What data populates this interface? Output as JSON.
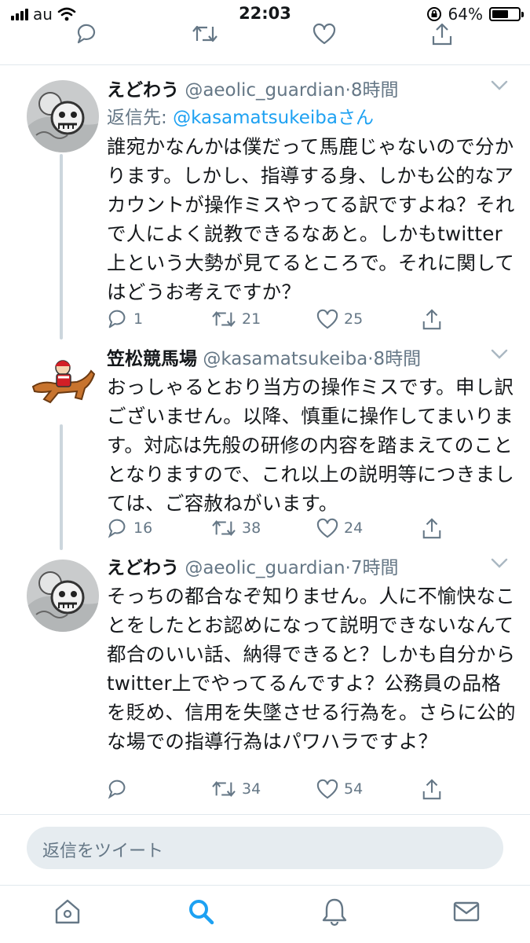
{
  "status_bar": {
    "carrier": "au",
    "time": "22:03",
    "battery_percent": "64%",
    "battery_level": 0.64,
    "icons": [
      "signal-bars-icon",
      "wifi-icon",
      "rotation-lock-icon",
      "battery-icon"
    ]
  },
  "tweets": [
    {
      "name": "えどわう",
      "handle": "@aeolic_guardian",
      "dot": "·",
      "time": "8時間",
      "reply_to_label": "返信先:",
      "reply_to_user": "@kasamatsukeibaさん",
      "text": "誰宛かなんかは僕だって馬鹿じゃないので分かります。しかし、指導する身、しかも公的なアカウントが操作ミスやってる訳ですよね？それで人によく説教できるなあと。しかもtwitter上という大勢が見てるところで。それに関してはどうお考えですか？",
      "replies": "1",
      "retweets": "21",
      "likes": "25"
    },
    {
      "name": "笠松競馬場",
      "handle": "@kasamatsukeiba",
      "dot": "·",
      "time": "8時間",
      "text": "おっしゃるとおり当方の操作ミスです。申し訳ございません。以降、慎重に操作してまいります。対応は先般の研修の内容を踏まえてのこととなりますので、これ以上の説明等につきましては、ご容赦ねがいます。",
      "replies": "16",
      "retweets": "38",
      "likes": "24"
    },
    {
      "name": "えどわう",
      "handle": "@aeolic_guardian",
      "dot": "·",
      "time": "7時間",
      "text": "そっちの都合なぞ知りません。人に不愉快なことをしたとお認めになって説明できないなんて都合のいい話、納得できると？しかも自分からtwitter上でやってるんですよ？公務員の品格を貶め、信用を失墜させる行為を。さらに公的な場での指導行為はパワハラですよ？",
      "replies": "",
      "retweets": "34",
      "likes": "54"
    }
  ],
  "compose": {
    "placeholder": "返信をツイート"
  },
  "tab_bar": {
    "icons": [
      "home-icon",
      "search-icon",
      "notifications-icon",
      "messages-icon"
    ],
    "active": "search-icon"
  },
  "colors": {
    "accent": "#1da1f2",
    "secondary_text": "#657786",
    "divider": "#e1e8ed",
    "compose_bg": "#e6ecf0"
  }
}
